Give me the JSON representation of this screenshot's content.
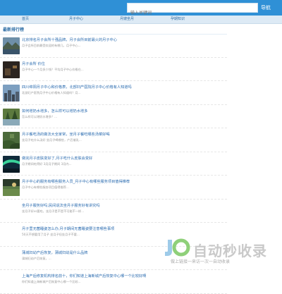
{
  "header": {
    "search_placeholder": "输入关键词",
    "search_button": "导航"
  },
  "nav": {
    "items": [
      "首页",
      "月子中心",
      "月嫂坐月",
      "孕期知识"
    ]
  },
  "section": {
    "title": "最新排行榜"
  },
  "list": [
    {
      "title": "北京排名月子会所十强品牌，月子会所目前最火的月子中心",
      "desc": "月子会所目前最受欢迎的有哪几，月子中心...",
      "thumb": "lake-mountain"
    },
    {
      "title": "月子会所 价位",
      "desc": "月子中心一个月多少钱？平均月子中心价格在...",
      "thumb": "dark-room"
    },
    {
      "title": "四川绵阳月子中心和价格表，北部妇产医院月子中心价格有人知道吗",
      "desc": "北部妇产医院月子中心价格有人知道吗？月...",
      "thumb": "city-sky"
    },
    {
      "title": "如何增奶水增多，怎么样可以增奶水增多",
      "desc": "怎么样可以增奶水增多？...",
      "thumb": "forest-pond"
    },
    {
      "title": "月子餐吃汤的做法大全家常，坐月子餐吃哪些汤菜好喝",
      "desc": "坐月子吃什么汤好 坐月子喝哪些，产后催乳...",
      "thumb": "green-hills"
    },
    {
      "title": "做完月子皮肤变好了,月子吃什么皮肤会变好",
      "desc": "月子期间吃得好 3月月子期间 3月内...",
      "thumb": "aurora"
    },
    {
      "title": "月子中心的服务有哪些服务人员_月子中心有哪些服务项目值得推荐",
      "desc": "月子中心有哪些服务项目值得推荐...",
      "thumb": "field-sunset"
    },
    {
      "title": "坐月子服务好吗,民间说法坐月子服务好有讲究吗",
      "desc": "坐月子好vs要吃，坐月子是不是不可能不一样...",
      "thumb": ""
    },
    {
      "title": "月子里无菌睡姿怎么办,月子期间无菌睡姿要注意哪些事项",
      "desc": "50天不想要用了月子 坐月子但坐月子不要...",
      "thumb": ""
    },
    {
      "title": "蒲城妇幼产后恢复，蒲城妇幼是什么品牌",
      "desc": "蒲城妇幼产后恢复，...",
      "thumb": ""
    },
    {
      "title": "上海产后修复机构排名前十，你们知道上海新城产后恢复中心哪一个比较好啊",
      "desc": "你们知道上海新城产后恢复中心哪一个比较...",
      "thumb": ""
    }
  ],
  "watermark": {
    "title": "自动秒收录",
    "subtitle": "做上链接一来访一次一自动收录"
  }
}
